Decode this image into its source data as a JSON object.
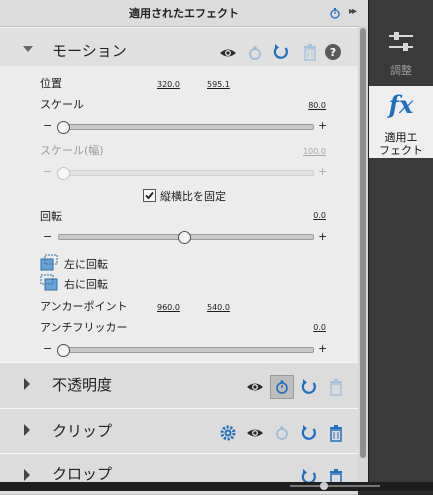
{
  "panel": {
    "title": "適用されたエフェクト"
  },
  "motion": {
    "title": "モーション",
    "position": {
      "label": "位置",
      "x": "320.0",
      "y": "595.1"
    },
    "scale": {
      "label": "スケール",
      "value": "80.0",
      "minus": "−",
      "plus": "+",
      "level": 0.0
    },
    "scale_width": {
      "label": "スケール(幅)",
      "value": "100.0",
      "minus": "−",
      "plus": "+",
      "level": 0.0
    },
    "uniform": {
      "label": "縦横比を固定",
      "checked": true
    },
    "rotation": {
      "label": "回転",
      "value": "0.0",
      "minus": "−",
      "plus": "+",
      "level": 0.5
    },
    "rotate_left": {
      "label": "左に回転"
    },
    "rotate_right": {
      "label": "右に回転"
    },
    "anchor": {
      "label": "アンカーポイント",
      "x": "960.0",
      "y": "540.0"
    },
    "flicker": {
      "label": "アンチフリッカー",
      "value": "0.0",
      "minus": "−",
      "plus": "+",
      "level": 0.0
    }
  },
  "opacity": {
    "title": "不透明度"
  },
  "clip": {
    "title": "クリップ"
  },
  "crop": {
    "title": "クロップ"
  },
  "rail": {
    "adjust_label": "調整",
    "fx_glyph": "fx",
    "fx_label_line1": "適用エ",
    "fx_label_line2": "フェクト"
  },
  "colors": {
    "accent_blue": "#1f6fc1",
    "panel_bg": "#e9e9e9",
    "rail_bg": "#3a3a3a"
  }
}
